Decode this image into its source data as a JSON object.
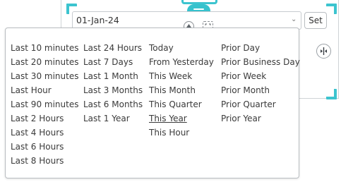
{
  "date_picker": {
    "value": "01-Jan-24",
    "set_label": "Set"
  },
  "colors": {
    "accent": "#3cc4cf",
    "text": "#3a3a3a",
    "border": "#b9bdc1"
  },
  "icons": {
    "drag_handle": "drag-handle-icon",
    "dropdown_arrow": "chevron-down-icon",
    "move_up": "arrow-up-icon",
    "expand": "expand-icon",
    "split": "split-horizontal-icon"
  },
  "dropdown": {
    "selected": "This Year",
    "columns": [
      [
        "Last 10 minutes",
        "Last 20 minutes",
        "Last 30 minutes",
        "Last Hour",
        "Last 90 minutes",
        "Last 2 Hours",
        "Last 4 Hours",
        "Last 6 Hours",
        "Last 8 Hours"
      ],
      [
        "Last 24 Hours",
        "Last 7 Days",
        "Last 1 Month",
        "Last 3 Months",
        "Last 6 Months",
        "Last 1 Year"
      ],
      [
        "Today",
        "From Yesterday",
        "This Week",
        "This Month",
        "This Quarter",
        "This Year",
        "This Hour"
      ],
      [
        "Prior Day",
        "Prior Business Day",
        "Prior Week",
        "Prior Month",
        "Prior Quarter",
        "Prior Year"
      ]
    ]
  }
}
